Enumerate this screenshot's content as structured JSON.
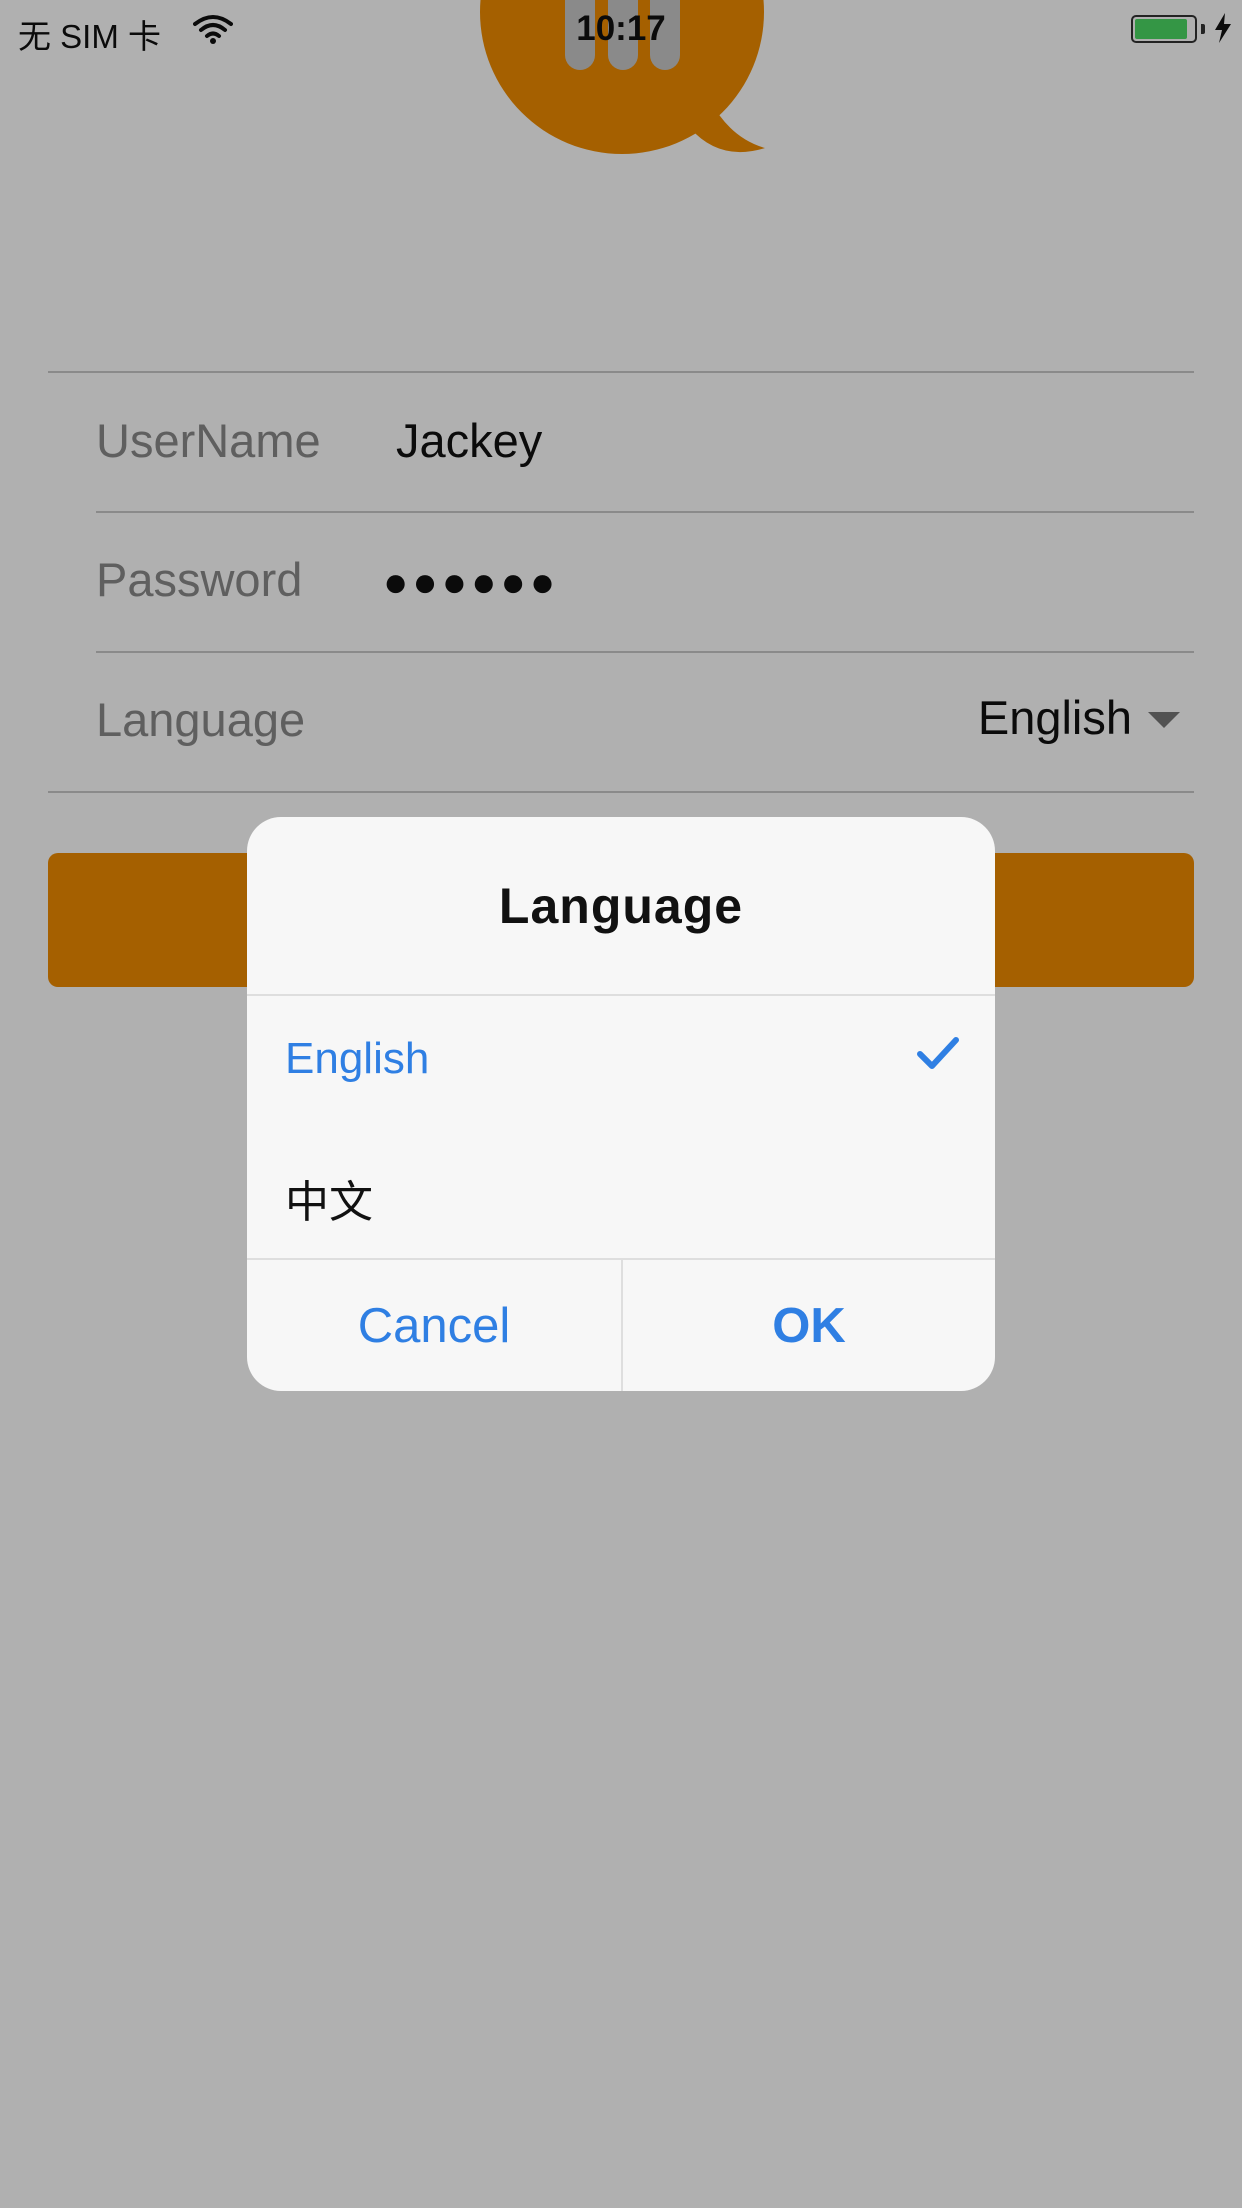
{
  "status_bar": {
    "carrier": "无 SIM 卡",
    "time": "10:17",
    "battery_level": 0.9,
    "charging": true
  },
  "login_form": {
    "username_label": "UserName",
    "username_value": "Jackey",
    "password_label": "Password",
    "password_value": "●●●●●●",
    "language_label": "Language",
    "language_value": "English"
  },
  "language_dialog": {
    "title": "Language",
    "options": [
      {
        "label": "English",
        "selected": true
      },
      {
        "label": "中文",
        "selected": false
      }
    ],
    "cancel_label": "Cancel",
    "ok_label": "OK"
  },
  "colors": {
    "accent_orange": "#f08c00",
    "selection_blue": "#2f7fe3",
    "battery_green": "#4cd964"
  },
  "icons": [
    "wifi-icon",
    "battery-icon",
    "charging-bolt-icon",
    "mi-logo",
    "dropdown-caret-icon",
    "checkmark-icon"
  ]
}
